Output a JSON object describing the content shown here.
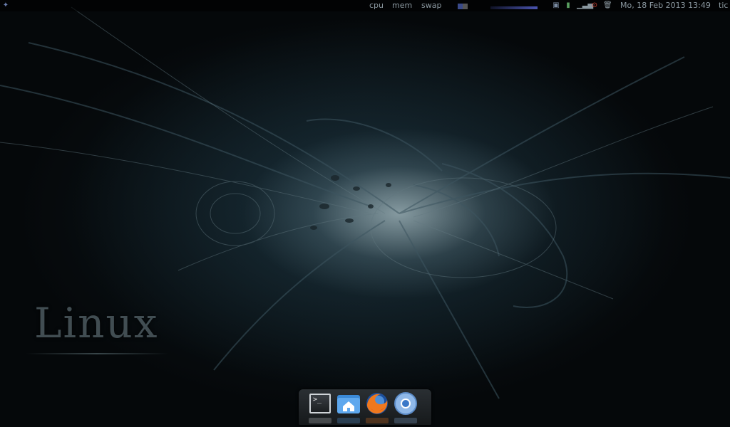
{
  "panel": {
    "cpu_label": "cpu",
    "mem_label": "mem",
    "swap_label": "swap",
    "datetime": "Mo, 18 Feb 2013 13:49",
    "user": "tic"
  },
  "desktop": {
    "logo_text": "Linux"
  },
  "dock": {
    "items": [
      {
        "name": "terminal",
        "icon": "terminal-icon",
        "glyph": ">_"
      },
      {
        "name": "home-folder",
        "icon": "home-folder-icon"
      },
      {
        "name": "firefox",
        "icon": "firefox-icon"
      },
      {
        "name": "chromium",
        "icon": "chromium-icon"
      }
    ]
  },
  "colors": {
    "panel_text": "#8b98a0",
    "accent": "#6b7fb0"
  }
}
